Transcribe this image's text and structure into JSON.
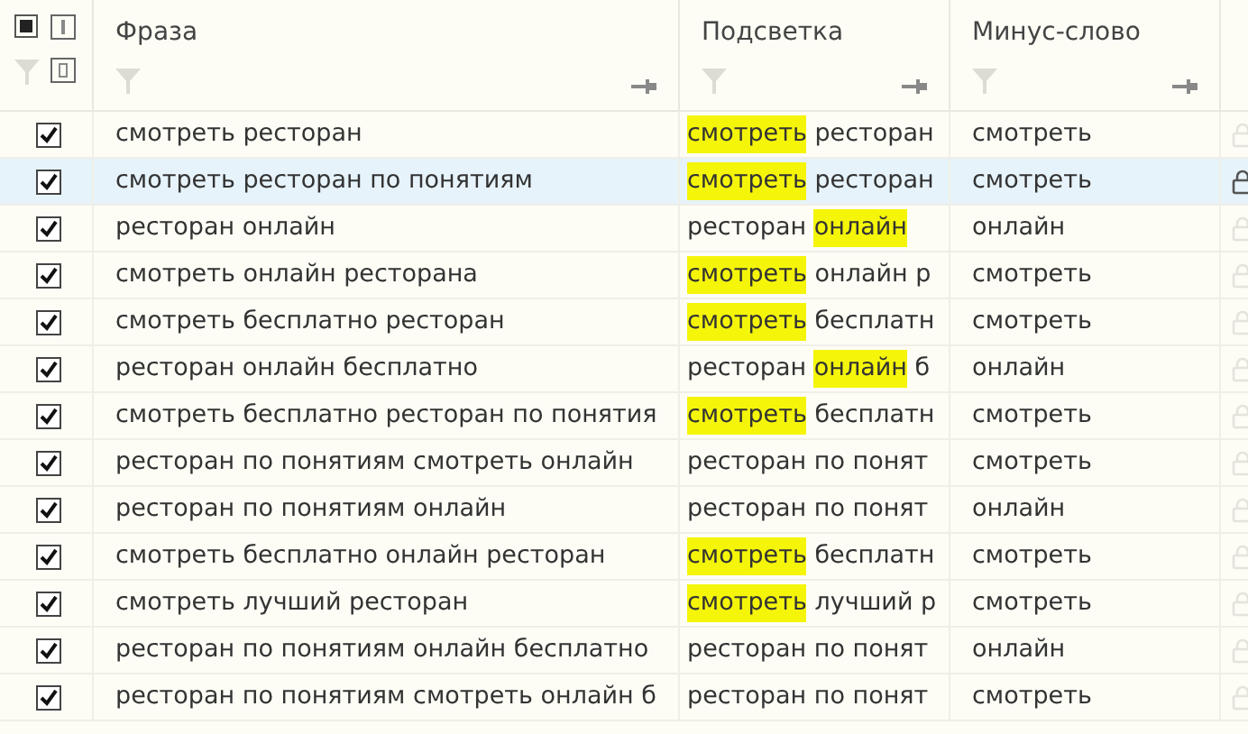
{
  "select_all": {
    "checked": true
  },
  "columns": [
    "Фраза",
    "Подсветка",
    "Минус-слово"
  ],
  "rows": [
    {
      "checked": true,
      "selected": false,
      "phrase": "смотреть ресторан",
      "highlight": [
        {
          "text": "смотреть",
          "highlighted": true
        },
        {
          "text": " ресторан",
          "highlighted": false
        }
      ],
      "minus_word": "смотреть"
    },
    {
      "checked": true,
      "selected": true,
      "phrase": "смотреть ресторан по понятиям",
      "highlight": [
        {
          "text": "смотреть",
          "highlighted": true
        },
        {
          "text": " ресторан",
          "highlighted": false
        }
      ],
      "minus_word": "смотреть"
    },
    {
      "checked": true,
      "selected": false,
      "phrase": "ресторан онлайн",
      "highlight": [
        {
          "text": "ресторан ",
          "highlighted": false
        },
        {
          "text": "онлайн",
          "highlighted": true
        }
      ],
      "minus_word": "онлайн"
    },
    {
      "checked": true,
      "selected": false,
      "phrase": "смотреть онлайн ресторана",
      "highlight": [
        {
          "text": "смотреть",
          "highlighted": true
        },
        {
          "text": " онлайн р",
          "highlighted": false
        }
      ],
      "minus_word": "смотреть"
    },
    {
      "checked": true,
      "selected": false,
      "phrase": "смотреть бесплатно ресторан",
      "highlight": [
        {
          "text": "смотреть",
          "highlighted": true
        },
        {
          "text": " бесплатн",
          "highlighted": false
        }
      ],
      "minus_word": "смотреть"
    },
    {
      "checked": true,
      "selected": false,
      "phrase": "ресторан онлайн бесплатно",
      "highlight": [
        {
          "text": "ресторан ",
          "highlighted": false
        },
        {
          "text": "онлайн",
          "highlighted": true
        },
        {
          "text": " б",
          "highlighted": false
        }
      ],
      "minus_word": "онлайн"
    },
    {
      "checked": true,
      "selected": false,
      "phrase": "смотреть бесплатно ресторан по понятия",
      "highlight": [
        {
          "text": "смотреть",
          "highlighted": true
        },
        {
          "text": " бесплатн",
          "highlighted": false
        }
      ],
      "minus_word": "смотреть"
    },
    {
      "checked": true,
      "selected": false,
      "phrase": "ресторан по понятиям смотреть онлайн",
      "highlight": [
        {
          "text": "ресторан по понят",
          "highlighted": false
        }
      ],
      "minus_word": "смотреть"
    },
    {
      "checked": true,
      "selected": false,
      "phrase": "ресторан по понятиям онлайн",
      "highlight": [
        {
          "text": "ресторан по понят",
          "highlighted": false
        }
      ],
      "minus_word": "онлайн"
    },
    {
      "checked": true,
      "selected": false,
      "phrase": "смотреть бесплатно онлайн ресторан",
      "highlight": [
        {
          "text": "смотреть",
          "highlighted": true
        },
        {
          "text": " бесплатн",
          "highlighted": false
        }
      ],
      "minus_word": "смотреть"
    },
    {
      "checked": true,
      "selected": false,
      "phrase": "смотреть лучший ресторан",
      "highlight": [
        {
          "text": "смотреть",
          "highlighted": true
        },
        {
          "text": " лучший р",
          "highlighted": false
        }
      ],
      "minus_word": "смотреть"
    },
    {
      "checked": true,
      "selected": false,
      "phrase": "ресторан по понятиям онлайн бесплатно",
      "highlight": [
        {
          "text": "ресторан по понят",
          "highlighted": false
        }
      ],
      "minus_word": "онлайн"
    },
    {
      "checked": true,
      "selected": false,
      "phrase": "ресторан по понятиям смотреть онлайн б",
      "highlight": [
        {
          "text": "ресторан по понят",
          "highlighted": false
        }
      ],
      "minus_word": "смотреть"
    }
  ]
}
